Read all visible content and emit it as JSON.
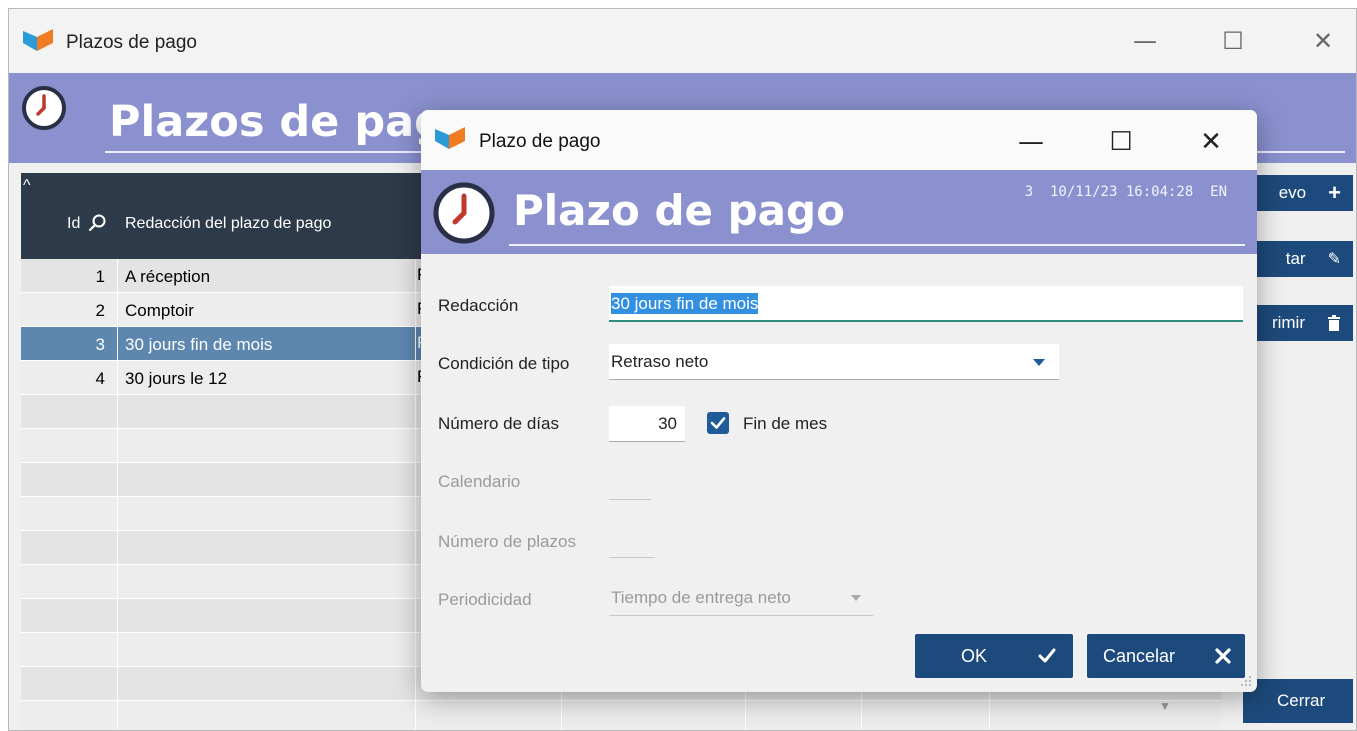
{
  "outer_window": {
    "title": "Plazos de pago",
    "heading": "Plazos de pago",
    "controls": {
      "minimize": "—",
      "maximize": "☐",
      "close": "✕"
    }
  },
  "grid": {
    "columns": {
      "id": "Id",
      "redaccion": "Redacción del plazo de pago"
    },
    "rows": [
      {
        "id": "1",
        "name": "A réception",
        "col3": "R"
      },
      {
        "id": "2",
        "name": "Comptoir",
        "col3": "R"
      },
      {
        "id": "3",
        "name": "30 jours fin de mois",
        "col3": "R"
      },
      {
        "id": "4",
        "name": "30 jours le 12",
        "col3": "R"
      }
    ],
    "selected_row_id": "3"
  },
  "side_buttons": {
    "nuevo": "evo",
    "editar": "tar",
    "suprimir": "rimir",
    "cerrar": "Cerrar"
  },
  "dialog": {
    "title": "Plazo de pago",
    "heading": "Plazo de pago",
    "meta": "3  10/11/23 16:04:28  EN",
    "fields": {
      "redaccion_label": "Redacción",
      "redaccion_value": "30 jours fin de mois",
      "condicion_label": "Condición de tipo",
      "condicion_value": "Retraso neto",
      "numero_dias_label": "Número de días",
      "numero_dias_value": "30",
      "fin_de_mes_label": "Fin de mes",
      "fin_de_mes_checked": true,
      "calendario_label": "Calendario",
      "numero_plazos_label": "Número de plazos",
      "periodicidad_label": "Periodicidad",
      "periodicidad_value": "Tiempo de entrega neto"
    },
    "buttons": {
      "ok": "OK",
      "cancel": "Cancelar"
    }
  },
  "colors": {
    "header_band": "#8b91cf",
    "grid_header": "#2d3a49",
    "selected_row": "#5e87b0",
    "button": "#1d4a7c",
    "focus_underline": "#2e8b7d"
  }
}
